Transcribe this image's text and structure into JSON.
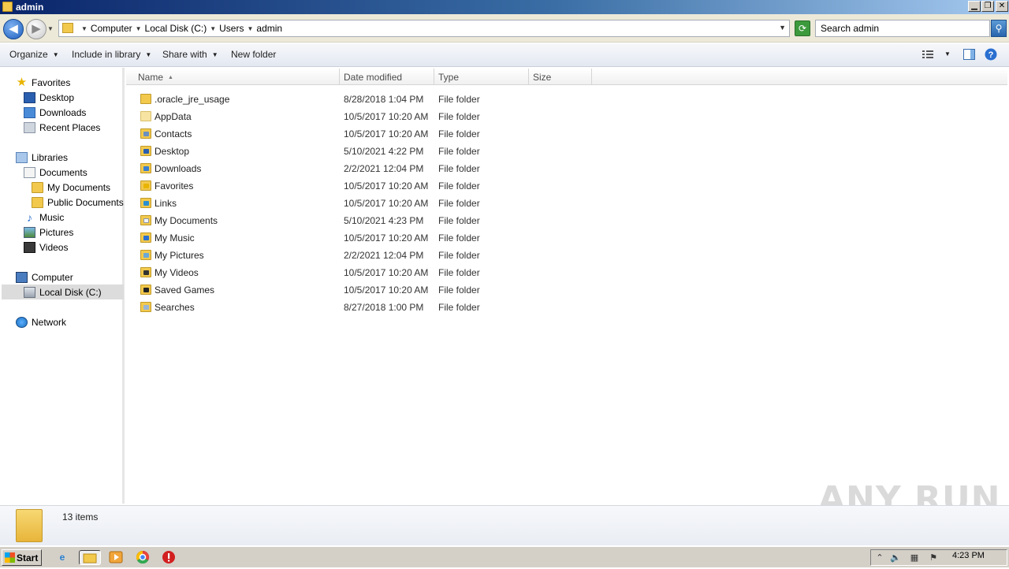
{
  "window": {
    "title": "admin",
    "controls": [
      "minimize-icon",
      "restore-icon",
      "close-icon"
    ]
  },
  "address": {
    "breadcrumbs": [
      "Computer",
      "Local Disk (C:)",
      "Users",
      "admin"
    ],
    "search_placeholder": "Search admin"
  },
  "toolbar": {
    "organize": "Organize",
    "include_in_library": "Include in library",
    "share_with": "Share with",
    "new_folder": "New folder"
  },
  "nav": {
    "favorites": "Favorites",
    "desktop": "Desktop",
    "downloads": "Downloads",
    "recent_places": "Recent Places",
    "libraries": "Libraries",
    "documents": "Documents",
    "my_documents": "My Documents",
    "public_documents": "Public Documents",
    "music": "Music",
    "pictures": "Pictures",
    "videos": "Videos",
    "computer": "Computer",
    "local_disk": "Local Disk (C:)",
    "network": "Network"
  },
  "columns": {
    "name": "Name",
    "date_modified": "Date modified",
    "type": "Type",
    "size": "Size"
  },
  "files": [
    {
      "name": ".oracle_jre_usage",
      "date": "8/28/2018 1:04 PM",
      "type": "File folder"
    },
    {
      "name": "AppData",
      "date": "10/5/2017 10:20 AM",
      "type": "File folder"
    },
    {
      "name": "Contacts",
      "date": "10/5/2017 10:20 AM",
      "type": "File folder"
    },
    {
      "name": "Desktop",
      "date": "5/10/2021 4:22 PM",
      "type": "File folder"
    },
    {
      "name": "Downloads",
      "date": "2/2/2021 12:04 PM",
      "type": "File folder"
    },
    {
      "name": "Favorites",
      "date": "10/5/2017 10:20 AM",
      "type": "File folder"
    },
    {
      "name": "Links",
      "date": "10/5/2017 10:20 AM",
      "type": "File folder"
    },
    {
      "name": "My Documents",
      "date": "5/10/2021 4:23 PM",
      "type": "File folder"
    },
    {
      "name": "My Music",
      "date": "10/5/2017 10:20 AM",
      "type": "File folder"
    },
    {
      "name": "My Pictures",
      "date": "2/2/2021 12:04 PM",
      "type": "File folder"
    },
    {
      "name": "My Videos",
      "date": "10/5/2017 10:20 AM",
      "type": "File folder"
    },
    {
      "name": "Saved Games",
      "date": "10/5/2017 10:20 AM",
      "type": "File folder"
    },
    {
      "name": "Searches",
      "date": "8/27/2018 1:00 PM",
      "type": "File folder"
    }
  ],
  "details": {
    "item_count": "13 items"
  },
  "watermark": "ANY RUN",
  "taskbar": {
    "start": "Start",
    "clock": "4:23 PM"
  }
}
